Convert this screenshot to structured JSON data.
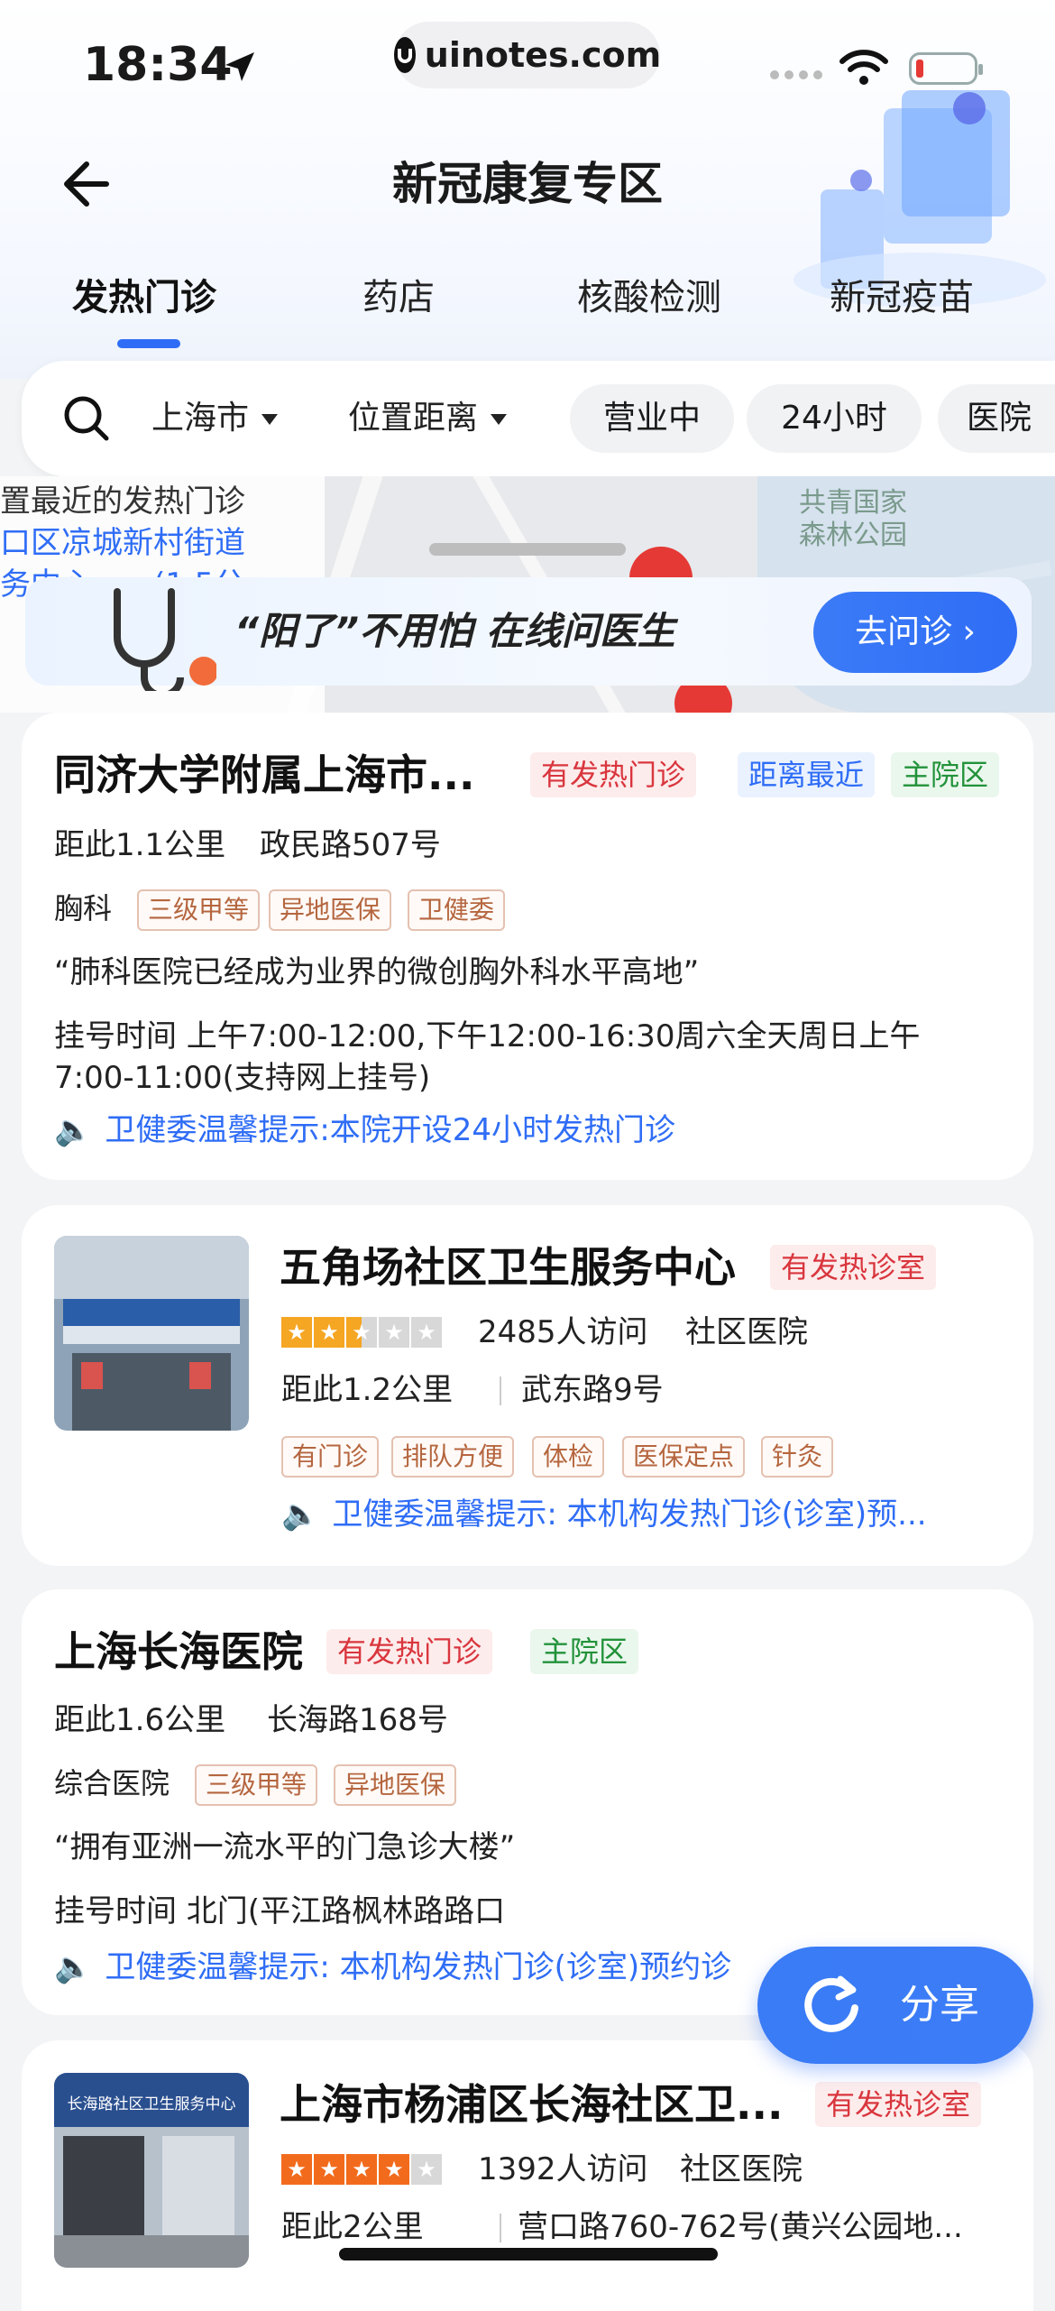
{
  "status_bar": {
    "time": "18:34",
    "url": "uinotes.com"
  },
  "header": {
    "title": "新冠康复专区"
  },
  "tabs": [
    {
      "label": "发热门诊"
    },
    {
      "label": "药店"
    },
    {
      "label": "核酸检测"
    },
    {
      "label": "新冠疫苗"
    }
  ],
  "filters": {
    "city": "上海市",
    "distance": "位置距离",
    "chips": [
      "营业中",
      "24小时",
      "医院"
    ]
  },
  "map": {
    "labels": [
      "诊",
      "置最近的发热门诊",
      "口区凉城新村街道",
      "务中心",
      "(1.5公",
      "共青国家",
      "森林公园"
    ]
  },
  "banner": {
    "text": "“阳了”不用怕 在线问医生",
    "button": "去问诊"
  },
  "listings": [
    {
      "title": "同济大学附属上海市...",
      "badges": [
        "有发热门诊",
        "距离最近",
        "主院区"
      ],
      "distance": "距此1.1公里",
      "address": "政民路507号",
      "category": "胸科",
      "tags": [
        "三级甲等",
        "异地医保",
        "卫健委"
      ],
      "quote": "“肺科医院已经成为业界的微创胸外科水平高地”",
      "hours_line1": "挂号时间 上午7:00-12:00,下午12:00-16:30周六全天周日上午",
      "hours_line2": "7:00-11:00(支持网上挂号)",
      "notice": "卫健委温馨提示:本院开设24小时发热门诊"
    },
    {
      "title": "五角场社区卫生服务中心",
      "badge": "有发热诊室",
      "rating": 2.5,
      "visits": "2485人访问",
      "type": "社区医院",
      "distance": "距此1.2公里",
      "address": "武东路9号",
      "tags": [
        "有门诊",
        "排队方便",
        "体检",
        "医保定点",
        "针灸"
      ],
      "notice": "卫健委温馨提示: 本机构发热门诊(诊室)预..."
    },
    {
      "title": "上海长海医院",
      "badges": [
        "有发热门诊",
        "主院区"
      ],
      "distance": "距此1.6公里",
      "address": "长海路168号",
      "category": "综合医院",
      "tags": [
        "三级甲等",
        "异地医保"
      ],
      "quote": "“拥有亚洲一流水平的门急诊大楼”",
      "hours": "挂号时间 北门(平江路枫林路路口",
      "notice": "卫健委温馨提示: 本机构发热门诊(诊室)预约诊"
    },
    {
      "title": "上海市杨浦区长海社区卫...",
      "badge": "有发热诊室",
      "rating": 4,
      "visits": "1392人访问",
      "type": "社区医院",
      "distance": "距此2公里",
      "address": "营口路760-762号(黄兴公园地...",
      "thumb_sign": "长海路社区卫生服务中心"
    }
  ],
  "share": {
    "label": "分享"
  },
  "colors": {
    "accent": "#2f6df6",
    "red": "#d9363e",
    "green": "#22923a",
    "star": "#f5a623"
  }
}
